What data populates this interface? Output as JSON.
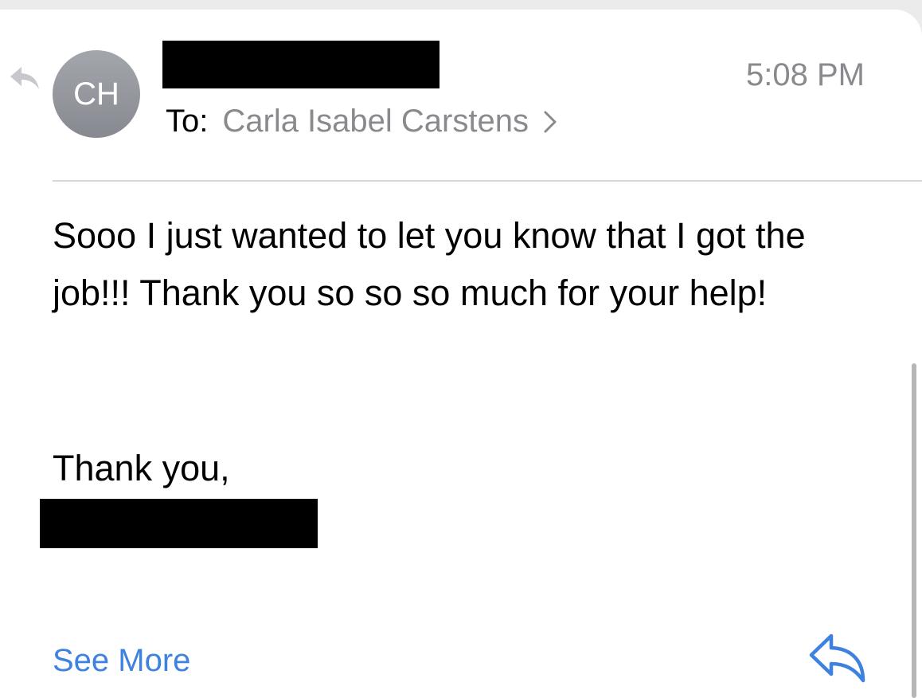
{
  "message": {
    "sender_initials": "CH",
    "time": "5:08 PM",
    "to_label": "To:",
    "recipient": "Carla Isabel Carstens",
    "body": "Sooo I just wanted to let you know that I got the job!!! Thank you so so so much for your help!",
    "signoff": "Thank you,"
  },
  "actions": {
    "see_more_label": "See More"
  },
  "icons": {
    "replied_indicator": "reply-arrow-icon",
    "recipient_chevron": "chevron-right-icon",
    "reply_button": "reply-icon"
  },
  "colors": {
    "accent": "#3d82e0",
    "secondary_text": "#8a8a8e",
    "avatar": "#9698a0"
  }
}
